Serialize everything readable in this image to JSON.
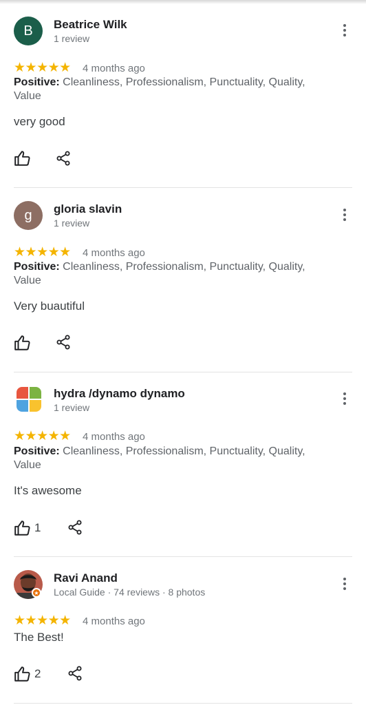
{
  "colors": {
    "star": "#f4b400",
    "avatar_b": "#1b5e4a",
    "avatar_g": "#8d6e63"
  },
  "reviews": [
    {
      "name": "Beatrice Wilk",
      "sub": "1 review",
      "avatar_letter": "B",
      "stars": "★★★★★",
      "date": "4 months ago",
      "positive_label": "Positive:",
      "positive_text": " Cleanliness, Professionalism, Punctuality, Quality, Value",
      "text": "very good",
      "likes": ""
    },
    {
      "name": "gloria slavin",
      "sub": "1 review",
      "avatar_letter": "g",
      "stars": "★★★★★",
      "date": "4 months ago",
      "positive_label": "Positive:",
      "positive_text": " Cleanliness, Professionalism, Punctuality, Quality, Value",
      "text": "Very buautiful",
      "likes": ""
    },
    {
      "name": "hydra /dynamo dynamo",
      "sub": "1 review",
      "stars": "★★★★★",
      "date": "4 months ago",
      "positive_label": "Positive:",
      "positive_text": " Cleanliness, Professionalism, Punctuality, Quality, Value",
      "text": "It's awesome",
      "likes": "1"
    },
    {
      "name": "Ravi Anand",
      "sub": "Local Guide · 74 reviews · 8 photos",
      "stars": "★★★★★",
      "date": "4 months ago",
      "text": "The Best!",
      "likes": "2"
    }
  ]
}
